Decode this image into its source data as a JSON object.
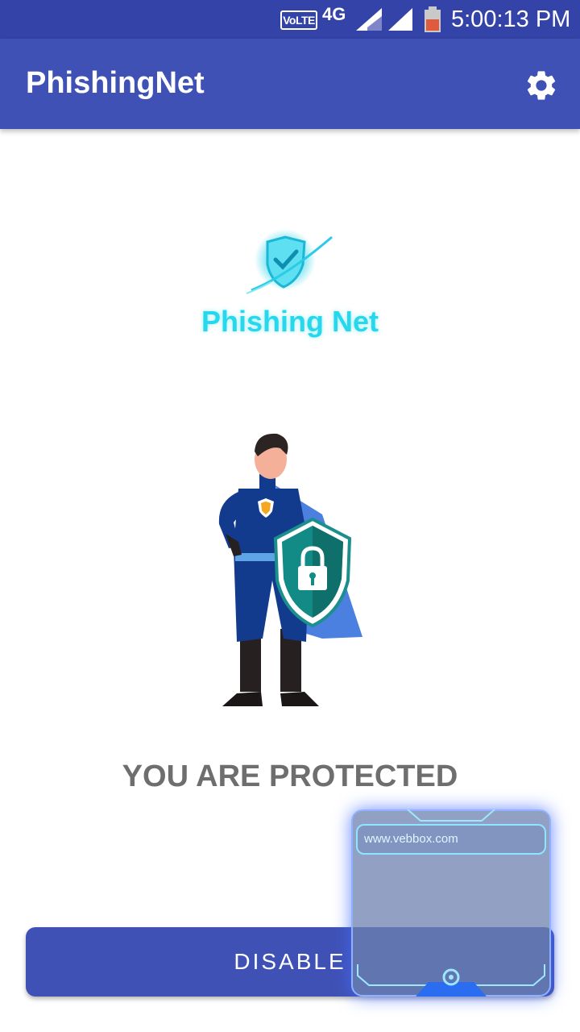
{
  "status_bar": {
    "volte": "VoLTE",
    "network": "4G",
    "time": "5:00:13 PM"
  },
  "app_bar": {
    "title": "PhishingNet",
    "settings_icon": "gear-icon"
  },
  "logo": {
    "text": "Phishing Net",
    "icon": "shield-check-icon"
  },
  "hero": {
    "illustration": "superhero-with-lock-shield"
  },
  "status_message": "YOU ARE PROTECTED",
  "disable_button": "DISABLE",
  "overlay": {
    "url": "www.vebbox.com"
  },
  "colors": {
    "status_bar": "#3443a7",
    "app_bar": "#3f51b5",
    "logo_text": "#27d8ec",
    "status_text": "#6e6e6e"
  }
}
